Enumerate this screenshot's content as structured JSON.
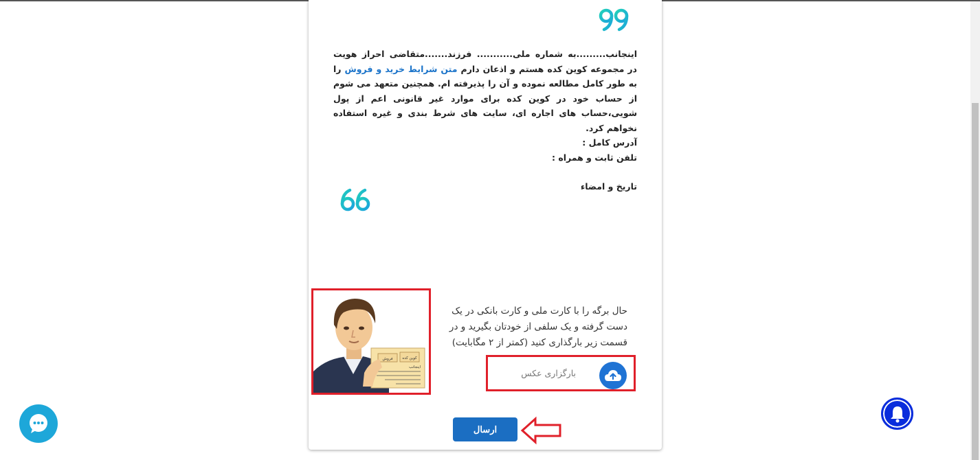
{
  "letter": {
    "line1": "اینجانب.........به شماره ملی........... فرزند.......متقاضی احراز هویت در مجموعه کوین کده هستم و اذعان دارم",
    "link": "متن شرایط خرید و فروش",
    "line1_after": "را به طور کامل مطالعه نموده و آن را پذیرفته ام. همچنین متعهد می شوم از حساب خود در کوین کده برای موارد غیر قانونی اعم از پول شویی،حساب های اجاره ای، سایت های شرط بندی و غیره استفاده نخواهم کرد.",
    "address": "آدرس کامل :",
    "phone": "تلفن ثابت و همراه :",
    "signature": "تاریخ و امضاء"
  },
  "upload": {
    "instructions": "حال برگه را با کارت ملی و کارت بانکی در یک دست گرفته و یک سلفی از خودتان بگیرید و در قسمت زیر بارگذاری کنید (کمتر از ۲ مگابایت)",
    "label": "بارگزاری عکس"
  },
  "sample_card": {
    "title": "اینجانب",
    "tag1": "کوین کده",
    "tag2": "فروش"
  },
  "actions": {
    "send_label": "ارسال"
  },
  "colors": {
    "accent_quote": "#1fc7c7",
    "primary_button": "#1b6ec2",
    "highlight_border": "#e0202a",
    "chat_button": "#1da7d9",
    "bell_button": "#0a2ddc"
  },
  "icons": {
    "quote_close": "closing-quote-icon",
    "quote_open": "opening-quote-icon",
    "upload": "cloud-upload-icon",
    "chat": "chat-bubble-icon",
    "bell": "bell-icon",
    "arrow": "arrow-left-icon"
  }
}
